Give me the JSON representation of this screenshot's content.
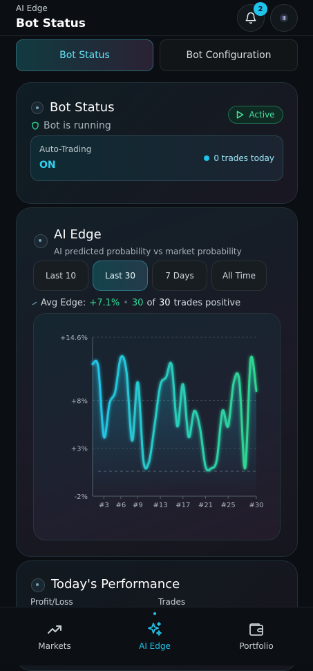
{
  "header": {
    "subtitle": "AI Edge",
    "title": "Bot Status",
    "notification_count": "2"
  },
  "tabs": [
    {
      "label": "Bot Status",
      "active": true
    },
    {
      "label": "Bot Configuration",
      "active": false
    }
  ],
  "bot_status": {
    "title": "Bot Status",
    "state_badge": "Active",
    "running_text": "Bot is running",
    "auto_trading_label": "Auto-Trading",
    "auto_trading_value": "ON",
    "trades_today": "0 trades today"
  },
  "ai_edge": {
    "title": "AI Edge",
    "subtitle": "AI predicted probability vs market probability",
    "filters": [
      {
        "label": "Last 10",
        "selected": false
      },
      {
        "label": "Last 30",
        "selected": true
      },
      {
        "label": "7 Days",
        "selected": false
      },
      {
        "label": "All Time",
        "selected": false
      }
    ],
    "avg_edge_label": "Avg Edge:",
    "avg_edge_value": "+7.1%",
    "separator": "•",
    "positive_count": "30",
    "positive_of": "of",
    "total_trades": "30",
    "positive_suffix": "trades positive"
  },
  "chart_data": {
    "type": "line",
    "y_ticks": [
      "+14.6%",
      "+8%",
      "+3%",
      "-2%"
    ],
    "y_tick_values": [
      14.6,
      8,
      3,
      -2
    ],
    "x_ticks": [
      "#3",
      "#6",
      "#9",
      "#13",
      "#17",
      "#21",
      "#25",
      "#30"
    ],
    "x_tick_values": [
      3,
      6,
      9,
      13,
      17,
      21,
      25,
      30
    ],
    "ylim": [
      -2,
      14.6
    ],
    "xlim": [
      1,
      30
    ],
    "reference_line": 0.6,
    "series": [
      {
        "x": [
          1,
          2,
          3,
          4,
          5,
          6,
          7,
          8,
          9,
          10,
          11,
          12,
          13,
          14,
          15,
          16,
          17,
          18,
          19,
          20,
          21,
          22,
          23,
          24,
          25,
          26,
          27,
          28,
          29,
          30
        ],
        "values": [
          11.8,
          11.5,
          4.2,
          7.7,
          8.9,
          12.5,
          11.0,
          3.8,
          9.9,
          1.7,
          1.6,
          5.5,
          9.6,
          10.4,
          11.7,
          5.3,
          9.7,
          4.2,
          6.9,
          5.2,
          1.1,
          0.9,
          1.8,
          6.9,
          5.3,
          9.9,
          10.0,
          0.9,
          12.3,
          9.0
        ]
      }
    ],
    "colors": {
      "start": "#22c3ea",
      "end": "#2fd68e"
    }
  },
  "performance": {
    "title": "Today's Performance",
    "col1": "Profit/Loss",
    "col2": "Trades"
  },
  "nav": [
    {
      "label": "Markets",
      "icon": "trending-up-icon",
      "active": false
    },
    {
      "label": "AI Edge",
      "icon": "sparkles-icon",
      "active": true
    },
    {
      "label": "Portfolio",
      "icon": "wallet-icon",
      "active": false
    }
  ],
  "accent_color": "#22c3ea",
  "positive_color": "#2ddc98"
}
